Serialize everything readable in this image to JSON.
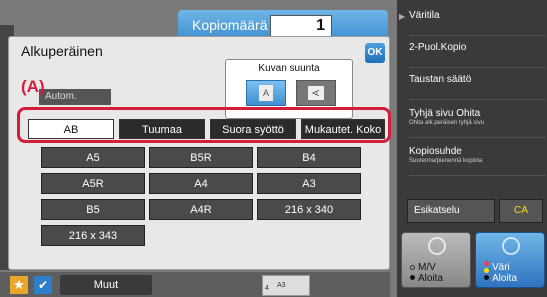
{
  "header": {
    "copy_count_label": "Kopiomäärä",
    "copy_count": "1"
  },
  "dialog": {
    "title": "Alkuperäinen",
    "ok_label": "OK",
    "orientation_label": "Kuvan suunta",
    "orientation_portrait_glyph": "A",
    "orientation_landscape_glyph": "A",
    "annotation_marker": "(A)",
    "auto_label": "Autom.",
    "tabs": [
      {
        "label": "AB"
      },
      {
        "label": "Tuumaa"
      },
      {
        "label": "Suora syöttö"
      },
      {
        "label": "Mukautet. Koko"
      }
    ],
    "sizes": [
      "A5",
      "B5R",
      "B4",
      "A5R",
      "A4",
      "A3",
      "B5",
      "A4R",
      "216 x 340",
      "216 x 343"
    ]
  },
  "footer": {
    "more_label": "Muut",
    "star_icon": "★",
    "check_icon": "✔",
    "thumb_label": "A3",
    "thumb_number": "4"
  },
  "right_panel": {
    "arrow_icon": "▶",
    "items": [
      {
        "label": "Väritila",
        "sub": ""
      },
      {
        "label": "2-Puol.Kopio",
        "sub": ""
      },
      {
        "label": "Taustan säätö",
        "sub": ""
      },
      {
        "label": "Tyhjä sivu Ohita",
        "sub": "Ohita alk.peräisen tyhjä sivu"
      },
      {
        "label": "Kopiosuhde",
        "sub": "Suurenna/pienennä kopiota"
      }
    ],
    "preview_label": "Esikatselu",
    "ca_label": "CA",
    "mono_start": {
      "line1": "M/V",
      "line2": "Aloita"
    },
    "color_start": {
      "line1": "Väri",
      "line2": "Aloita"
    }
  },
  "colors": {
    "accent_blue": "#3f8fd0",
    "highlight_red": "#d41c3c",
    "ca_yellow": "#f5e000"
  }
}
